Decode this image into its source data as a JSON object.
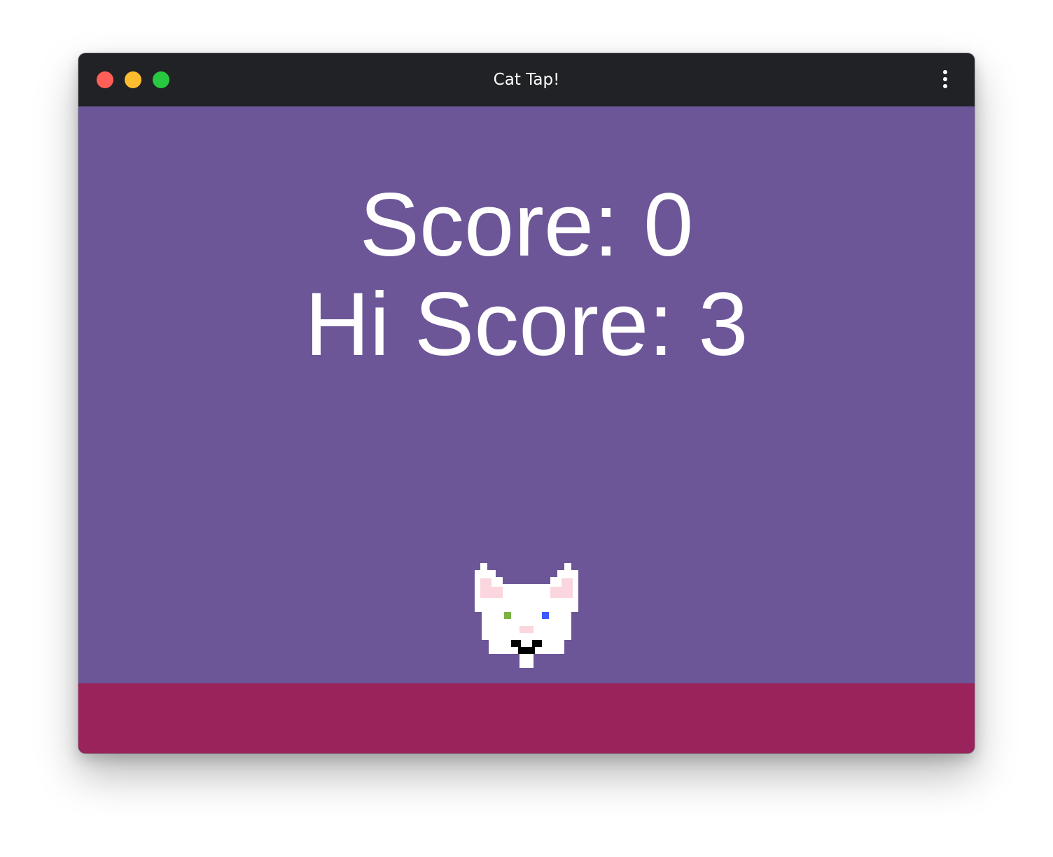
{
  "window": {
    "title": "Cat Tap!"
  },
  "colors": {
    "titlebar": "#212226",
    "sky": "#6c5698",
    "ground": "#99235a",
    "close": "#ff5f57",
    "minimize": "#febc2e",
    "zoom": "#28c840",
    "text": "#ffffff",
    "cat_fur": "#ffffff",
    "cat_inner_ear": "#fbd6de",
    "cat_left_eye": "#7cb342",
    "cat_right_eye": "#3d5afe",
    "cat_nose": "#fbd6de",
    "cat_mouth": "#000000"
  },
  "icons": {
    "menu": "more-vertical-icon",
    "sprite": "cat-face"
  },
  "game": {
    "score_text": "Score: 0",
    "hiscore_text": "Hi Score: 3",
    "score": 0,
    "hi_score": 3
  }
}
